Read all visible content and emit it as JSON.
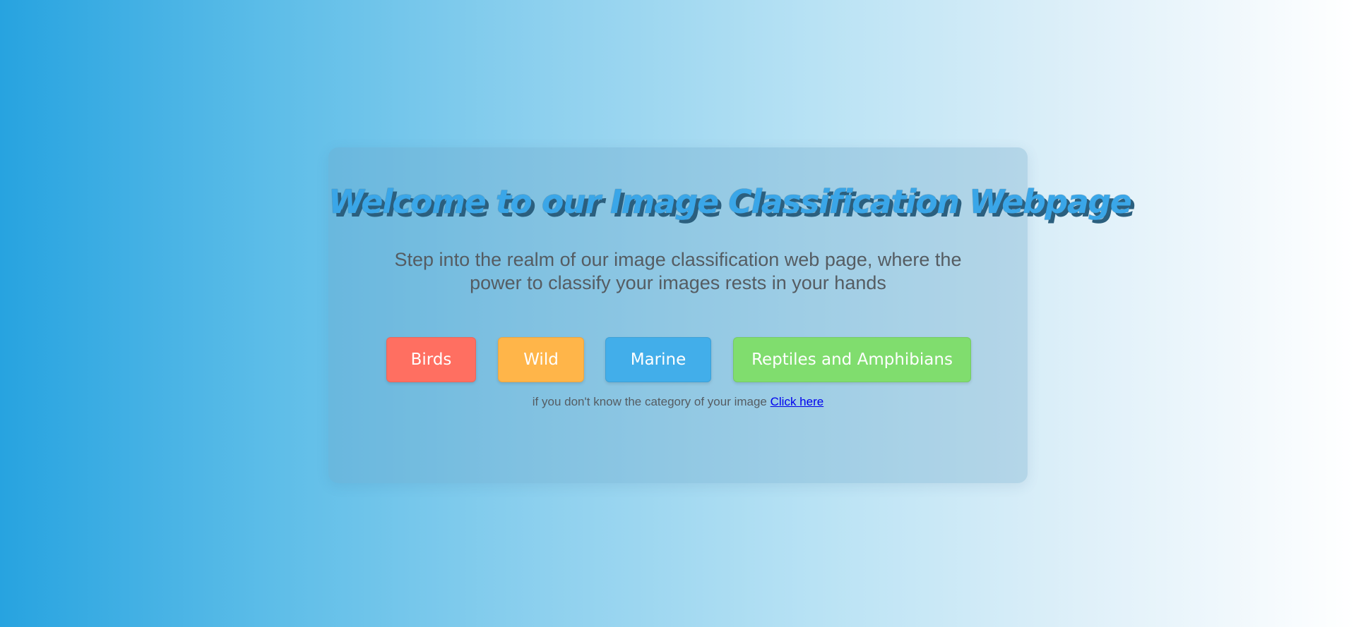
{
  "card": {
    "title": "Welcome to our Image Classification Webpage",
    "subtitle_line1": "Step into the realm of our image classification web page, where the",
    "subtitle_line2": "power to classify your images rests in your hands"
  },
  "categories": [
    {
      "label": "Birds",
      "color": "#ff6f61"
    },
    {
      "label": "Wild",
      "color": "#ffb549"
    },
    {
      "label": "Marine",
      "color": "#42aeea"
    },
    {
      "label": "Reptiles and Amphibians",
      "color": "#80dd6e"
    }
  ],
  "hint": {
    "text": "if you don't know the category of your image ",
    "link_label": "Click here"
  },
  "colors": {
    "title": "#3aa6e8",
    "title_shadow": "#2b5f7e",
    "text": "#555c62",
    "link": "#0000ee"
  }
}
